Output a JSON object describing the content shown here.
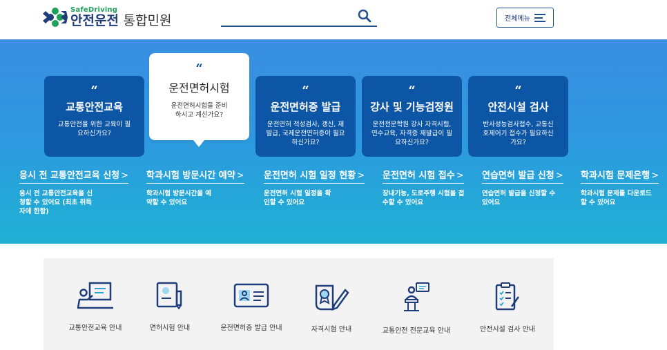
{
  "header": {
    "logo_sub": "SafeDriving",
    "logo_main": "안전운전",
    "logo_suffix": "통합민원",
    "search_placeholder": "",
    "menu_label": "전체메뉴"
  },
  "cards": [
    {
      "quote": "“",
      "title": "교통안전교육",
      "desc": "교통안전을 위한 교육이 필요하신가요?"
    },
    {
      "quote": "“",
      "title": "운전면허시험",
      "desc": "운전면허시험을 준비하시고 계신가요?"
    },
    {
      "quote": "“",
      "title": "운전면허증 발급",
      "desc": "운전면허 적성검사, 갱신, 재발급, 국제운전면허증이 필요하신가요?"
    },
    {
      "quote": "“",
      "title": "강사 및 기능검정원",
      "desc": "운전전문학원 강사 자격시험, 연수교육, 자격증 재발급이 필요하신가요?"
    },
    {
      "quote": "“",
      "title": "안전시설 검사",
      "desc": "반사성능검사접수, 교통신호제어기 접수가 필요하신가요?"
    }
  ],
  "links": [
    {
      "title": "응시 전 교통안전교육 신청",
      "arrow": ">",
      "desc": "응시 전 교통안전교육을 신청할 수 있어요 (최초 취득자에 한함)"
    },
    {
      "title": "학과시험 방문시간 예약",
      "arrow": ">",
      "desc": "학과시험 방문시간을 예약할 수 있어요"
    },
    {
      "title": "운전면허 시험 일정 현황",
      "arrow": ">",
      "desc": "운전면허 시험 일정을 확인할 수 있어요"
    },
    {
      "title": "운전면허 시험 접수",
      "arrow": ">",
      "desc": "장내기능, 도로주행 시험을 접수할 수 있어요"
    },
    {
      "title": "연습면허 발급 신청",
      "arrow": ">",
      "desc": "연습면허 발급을 신청할 수 있어요"
    },
    {
      "title": "학과시험 문제은행",
      "arrow": ">",
      "desc": "학과시험 문제를 다운로드 할 수 있어요"
    }
  ],
  "services": [
    {
      "label": "교통안전교육 안내",
      "icon": "teacher-board-icon"
    },
    {
      "label": "면허시험 안내",
      "icon": "document-pen-icon"
    },
    {
      "label": "운전면허증 발급 안내",
      "icon": "id-card-icon"
    },
    {
      "label": "자격시험 안내",
      "icon": "certificate-pen-icon"
    },
    {
      "label": "교통안전 전문교육 안내",
      "icon": "lecturer-podium-icon"
    },
    {
      "label": "안전시설 검사 안내",
      "icon": "checklist-icon"
    }
  ],
  "colors": {
    "brand_navy": "#1f3d7a",
    "brand_green": "#1ea05a",
    "card_blue": "#0d56a6",
    "hero_top": "#3a8fe0",
    "hero_bottom": "#22b0d4"
  }
}
